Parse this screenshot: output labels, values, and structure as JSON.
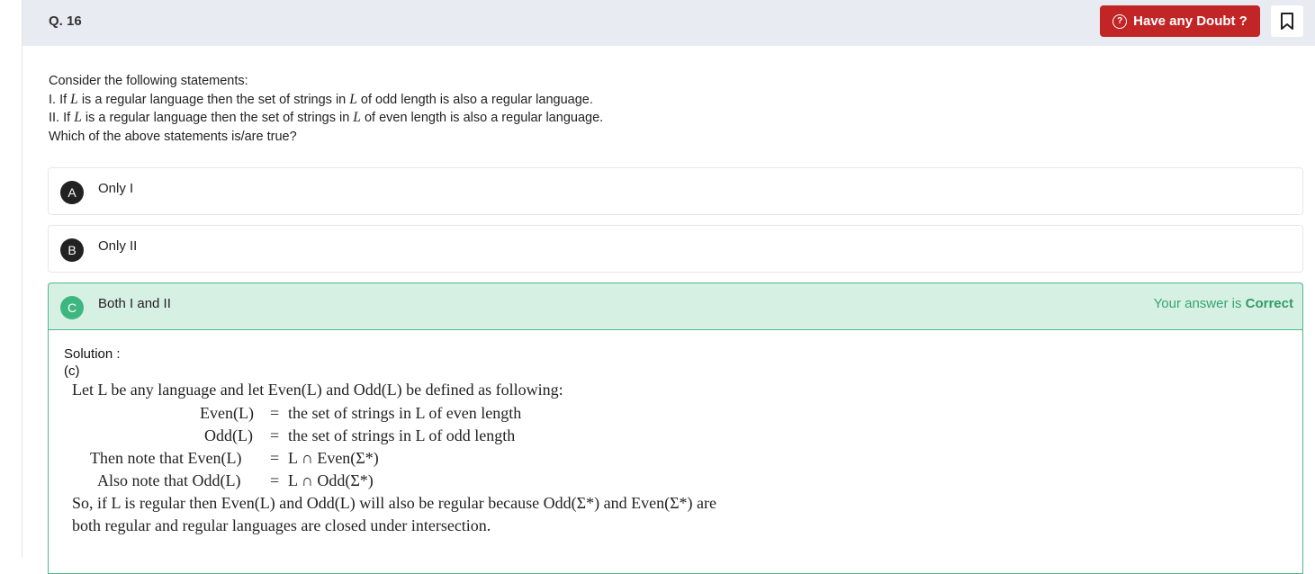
{
  "header": {
    "question_number": "Q. 16",
    "doubt_button": "Have any Doubt ?",
    "bookmark_icon": "bookmark-icon"
  },
  "question": {
    "intro": "Consider the following statements:",
    "s1_a": "I. If ",
    "s1_var": "L",
    "s1_b": " is a regular language then the set of strings in ",
    "s1_var2": "L",
    "s1_c": " of odd length is also a regular language.",
    "s2_a": "II. If ",
    "s2_var": "L",
    "s2_b": " is a regular language then the set of strings in ",
    "s2_var2": "L",
    "s2_c": " of even length is also a regular language.",
    "ask": "Which of the above statements is/are true?"
  },
  "options": [
    {
      "letter": "A",
      "text": "Only I"
    },
    {
      "letter": "B",
      "text": "Only II"
    },
    {
      "letter": "C",
      "text": "Both I and II"
    }
  ],
  "result": {
    "prefix": "Your answer is ",
    "status": "Correct"
  },
  "solution": {
    "title": "Solution :",
    "answer": "(c)",
    "line1": "Let L be any language and let Even(L) and Odd(L) be defined as following:",
    "even_lhs": "Even(L)",
    "even_rhs": "the set of strings in L of even length",
    "odd_lhs": "Odd(L)",
    "odd_rhs": "the set of strings in L of odd length",
    "then_lhs": "Then note that Even(L)",
    "then_rhs": "L ∩ Even(Σ*)",
    "also_lhs": "Also note that Odd(L)",
    "also_rhs": "L ∩ Odd(Σ*)",
    "eq": "=",
    "conclusion1": "So, if L is regular then Even(L) and Odd(L) will also be regular because Odd(Σ*) and Even(Σ*) are",
    "conclusion2": "both regular and regular languages are closed under intersection."
  },
  "colors": {
    "doubt_button": "#c22525",
    "correct_bg": "#d7f0e4",
    "correct_accent": "#3db77f"
  }
}
